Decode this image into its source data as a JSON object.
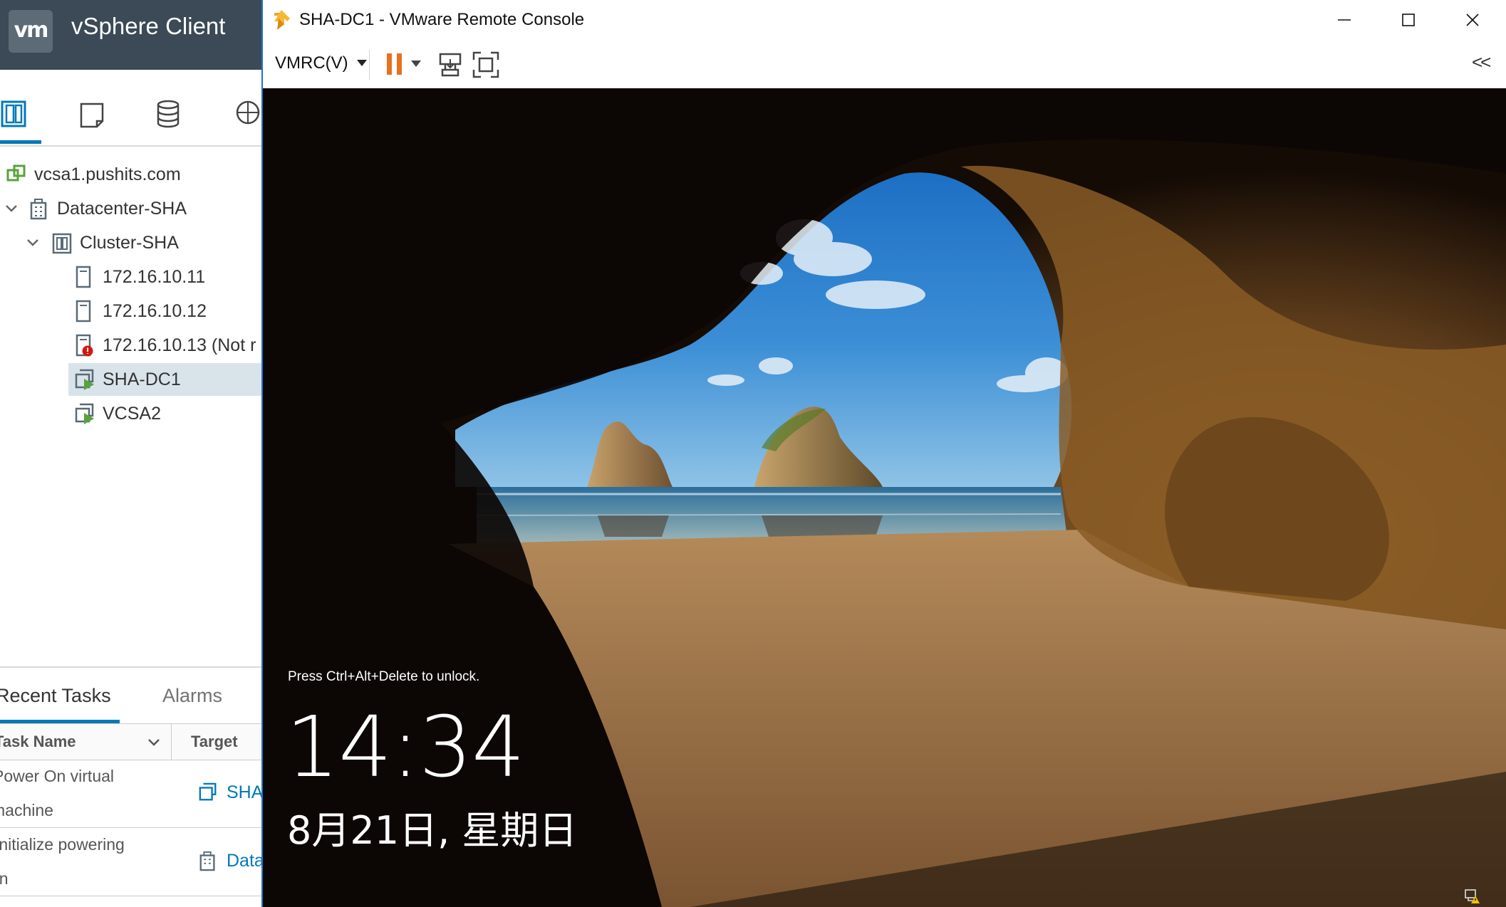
{
  "vsphere": {
    "app_title": "vSphere Client",
    "logo_text": "vm",
    "toolbar": {
      "icons": [
        "hosts-clusters-icon",
        "vms-templates-icon",
        "storage-icon",
        "networking-icon"
      ],
      "active_index": 0
    },
    "tree": {
      "vcenter": "vcsa1.pushits.com",
      "datacenter": "Datacenter-SHA",
      "cluster": "Cluster-SHA",
      "hosts": [
        "172.16.10.11",
        "172.16.10.12",
        "172.16.10.13 (Not r"
      ],
      "vms": [
        "SHA-DC1",
        "VCSA2"
      ],
      "selected": "SHA-DC1"
    },
    "tasks": {
      "tabs": [
        "Recent Tasks",
        "Alarms"
      ],
      "active_tab": "Recent Tasks",
      "columns": [
        "Task Name",
        "Target"
      ],
      "rows": [
        {
          "name_line1": "Power On virtual",
          "name_line2": "machine",
          "target": "SHA"
        },
        {
          "name_line1": "Initialize powering",
          "name_line2": "on",
          "target": "Data"
        }
      ]
    }
  },
  "vmrc": {
    "window_title": "SHA-DC1 - VMware Remote Console",
    "menu_label": "VMRC(V)",
    "window_controls": [
      "minimize",
      "maximize",
      "close"
    ],
    "collapse_label": "<<",
    "colors": {
      "pause": "#e8701f",
      "accent": "#1c73d6"
    }
  },
  "lockscreen": {
    "unlock_hint": "Press Ctrl+Alt+Delete to unlock.",
    "time": "14:34",
    "date": "8月21日, 星期日"
  }
}
